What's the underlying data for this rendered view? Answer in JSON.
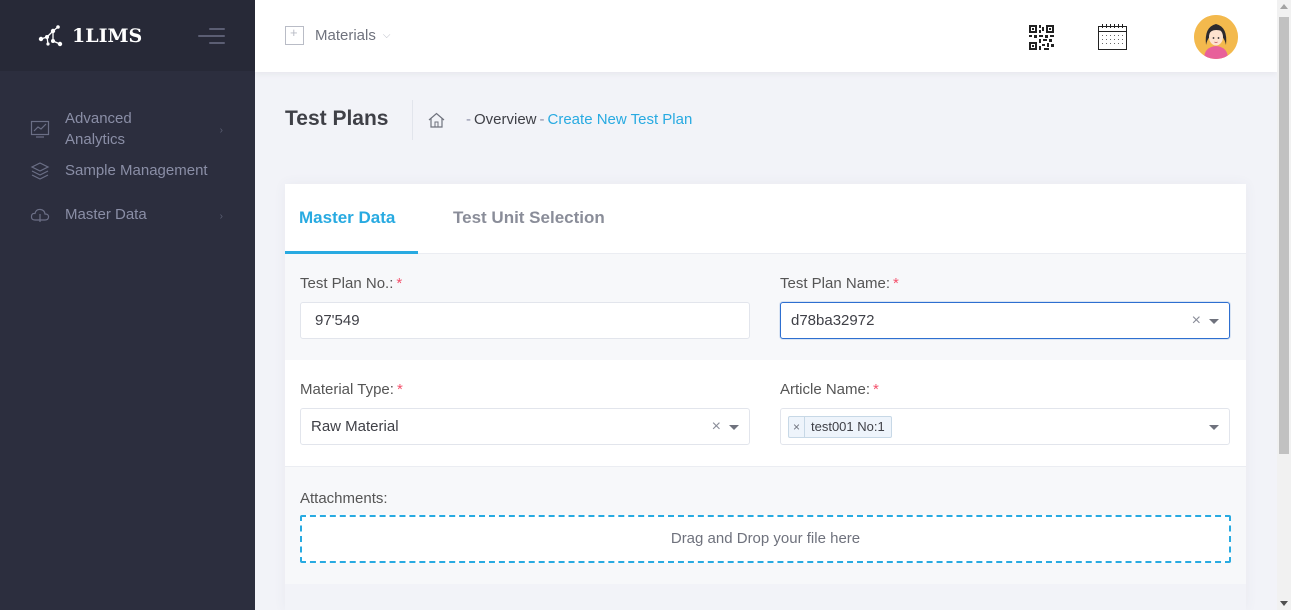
{
  "app": {
    "name": "1LIMS"
  },
  "sidebar": {
    "items": [
      {
        "label_line1": "Advanced",
        "label_line2": "Analytics",
        "icon": "chart-icon",
        "has_children": true
      },
      {
        "label": "Sample Management",
        "icon": "layers-icon",
        "has_children": false
      },
      {
        "label": "Master Data",
        "icon": "cloud-icon",
        "has_children": true
      }
    ]
  },
  "header": {
    "module": "Materials",
    "icons": [
      "qr-code-icon",
      "calendar-icon",
      "user-avatar"
    ]
  },
  "page": {
    "title": "Test Plans",
    "breadcrumb": {
      "home_icon": "home-icon",
      "overview": "Overview",
      "current": "Create New Test Plan",
      "separator": "-"
    }
  },
  "tabs": [
    {
      "label": "Master Data",
      "active": true
    },
    {
      "label": "Test Unit Selection",
      "active": false
    }
  ],
  "form": {
    "test_plan_no": {
      "label": "Test Plan No.:",
      "required_mark": "*",
      "value": "97'549"
    },
    "test_plan_name": {
      "label": "Test Plan Name:",
      "required_mark": "*",
      "value": "d78ba32972"
    },
    "material_type": {
      "label": "Material Type:",
      "required_mark": "*",
      "value": "Raw Material"
    },
    "article_name": {
      "label": "Article Name:",
      "required_mark": "*",
      "tag": "test001 No:1",
      "tag_remove": "×"
    },
    "attachments": {
      "label": "Attachments:",
      "dropzone_text": "Drag and Drop your file here"
    },
    "clear_symbol": "×"
  },
  "colors": {
    "sidebar_bg": "#2c2e3e",
    "accent": "#28aae1",
    "required": "#f4516c",
    "focus_border": "#2e6fd0"
  }
}
